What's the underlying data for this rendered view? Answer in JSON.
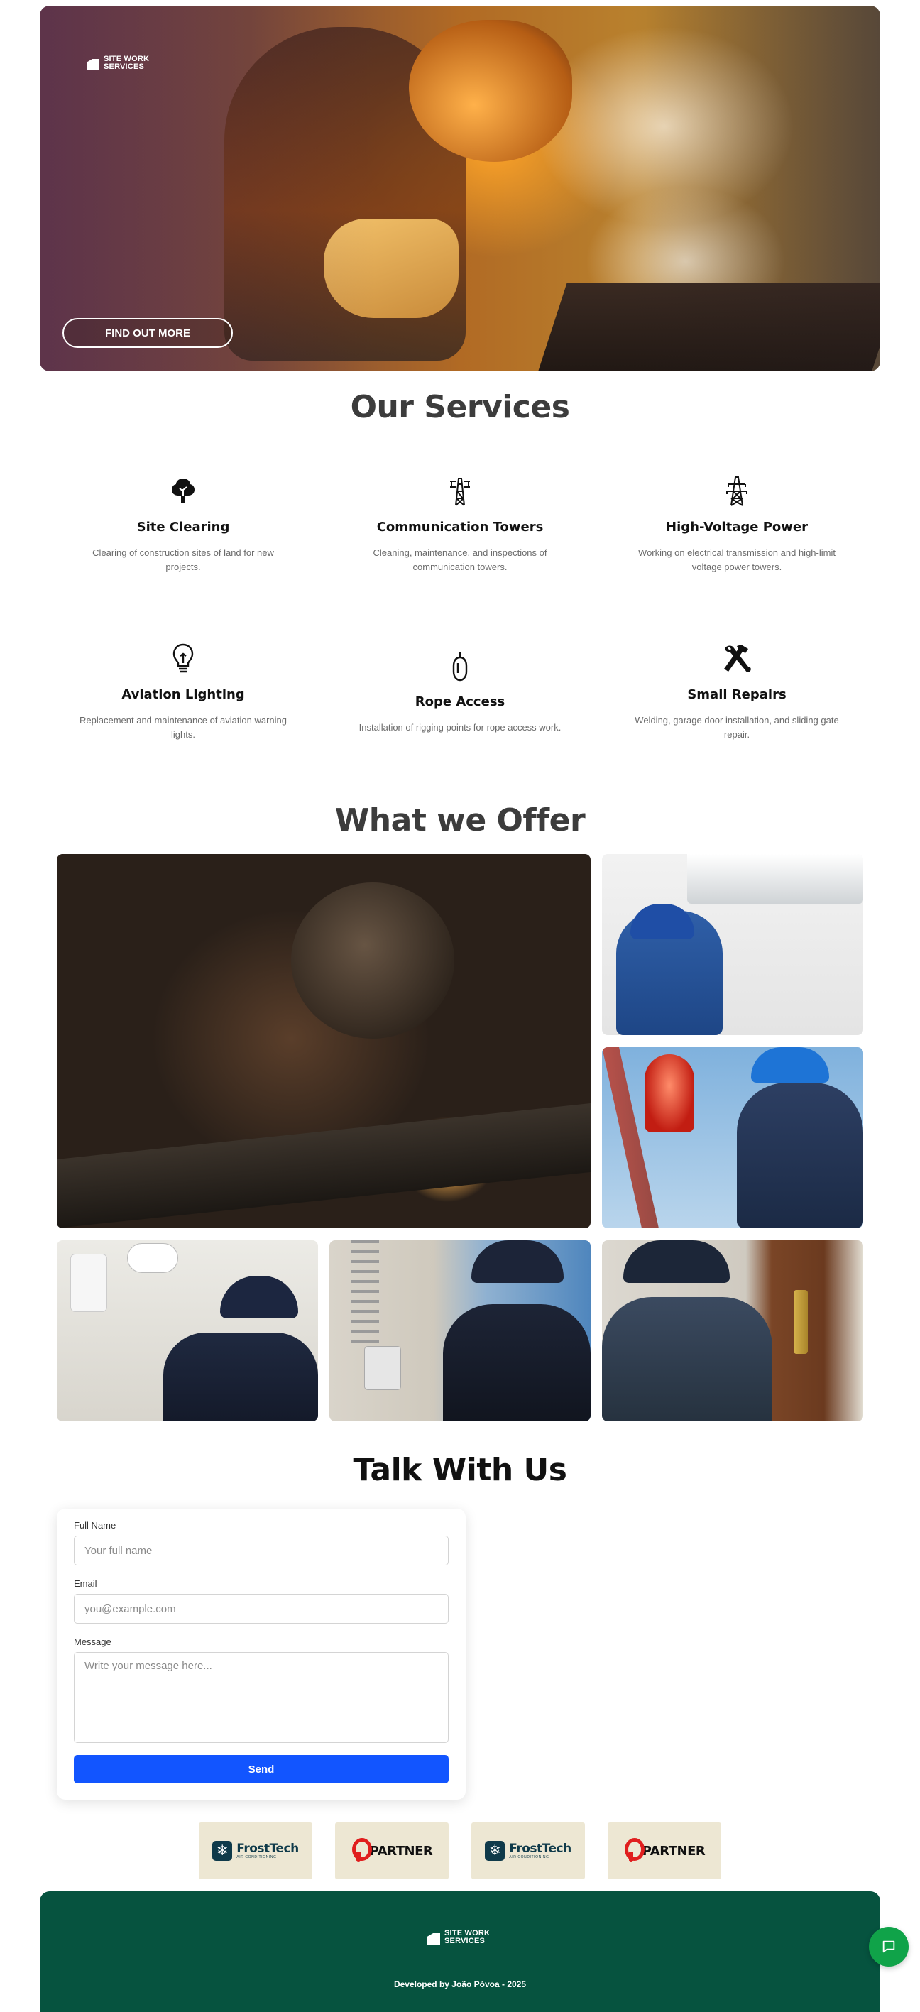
{
  "brand": {
    "line1": "SITE WORK",
    "line2": "SERVICES"
  },
  "hero": {
    "cta_label": "FIND OUT MORE"
  },
  "services": {
    "title": "Our Services",
    "items": [
      {
        "icon": "tree-icon",
        "title": "Site Clearing",
        "desc": "Clearing of construction sites of land for new projects."
      },
      {
        "icon": "communication-tower-icon",
        "title": "Communication Towers",
        "desc": "Cleaning, maintenance, and inspections of communication towers."
      },
      {
        "icon": "power-pylon-icon",
        "title": "High-Voltage Power",
        "desc": "Working on electrical transmission and high-limit voltage power towers."
      },
      {
        "icon": "lightbulb-icon",
        "title": "Aviation Lighting",
        "desc": "Replacement and maintenance of aviation warning lights."
      },
      {
        "icon": "carabiner-icon",
        "title": "Rope Access",
        "desc": "Installation of rigging points for rope access work."
      },
      {
        "icon": "hammer-wrench-icon",
        "title": "Small Repairs",
        "desc": "Welding, garage door installation, and sliding gate repair."
      }
    ]
  },
  "offer": {
    "title": "What we Offer"
  },
  "contact": {
    "title": "Talk With Us",
    "name_label": "Full Name",
    "name_placeholder": "Your full name",
    "email_label": "Email",
    "email_placeholder": "you@example.com",
    "message_label": "Message",
    "message_placeholder": "Write your message here...",
    "send_label": "Send"
  },
  "partners": [
    {
      "type": "frost",
      "name": "FrostTech",
      "sub": "AIR CONDITIONING"
    },
    {
      "type": "pin",
      "name": "PARTNER"
    },
    {
      "type": "frost",
      "name": "FrostTech",
      "sub": "AIR CONDITIONING"
    },
    {
      "type": "pin",
      "name": "PARTNER"
    }
  ],
  "footer": {
    "credit": "Developed by João Póvoa - 2025"
  },
  "colors": {
    "footer_bg": "#06533f",
    "send_button": "#1255ff",
    "chat_button": "#10a349",
    "partner_bg": "#ede7d3"
  },
  "chat": {
    "icon": "chat-bubble-icon"
  }
}
